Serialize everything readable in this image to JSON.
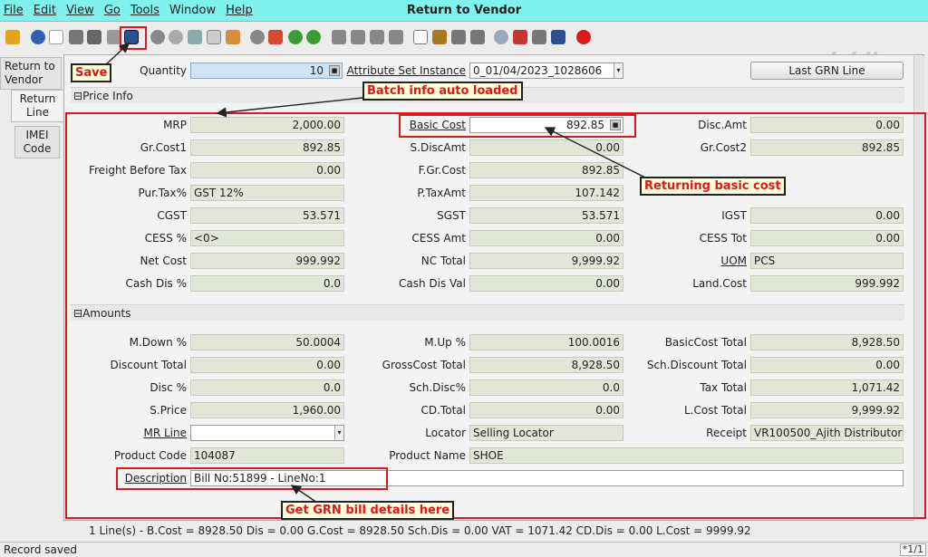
{
  "window": {
    "title": "Return to Vendor"
  },
  "menu": [
    "File",
    "Edit",
    "View",
    "Go",
    "Tools",
    "Window",
    "Help"
  ],
  "brand": "jaldi",
  "tabs": [
    "Return to Vendor",
    "Return Line",
    "IMEI Code"
  ],
  "top": {
    "quantity_label": "Quantity",
    "quantity": "10",
    "attr_label": "Attribute Set Instance",
    "attr_value": "0_01/04/2023_1028606",
    "last_grn": "Last GRN Line"
  },
  "price_section": "Price Info",
  "amount_section": "Amounts",
  "price": {
    "mrp_l": "MRP",
    "mrp": "2,000.00",
    "basic_l": "Basic Cost",
    "basic": "892.85",
    "disc_l": "Disc.Amt",
    "disc": "0.00",
    "grc1_l": "Gr.Cost1",
    "grc1": "892.85",
    "sdisc_l": "S.DiscAmt",
    "sdisc": "0.00",
    "grc2_l": "Gr.Cost2",
    "grc2": "892.85",
    "fbt_l": "Freight Before Tax",
    "fbt": "0.00",
    "fgr_l": "F.Gr.Cost",
    "fgr": "892.85",
    "ptax_l": "Pur.Tax%",
    "ptax": "GST 12%",
    "ptaxamt_l": "P.TaxAmt",
    "ptaxamt": "107.142",
    "cgst_l": "CGST",
    "cgst": "53.571",
    "sgst_l": "SGST",
    "sgst": "53.571",
    "igst_l": "IGST",
    "igst": "0.00",
    "cess_l": "CESS %",
    "cess": "<0>",
    "cessamt_l": "CESS Amt",
    "cessamt": "0.00",
    "cesstot_l": "CESS Tot",
    "cesstot": "0.00",
    "net_l": "Net Cost",
    "net": "999.992",
    "nct_l": "NC Total",
    "nct": "9,999.92",
    "uom_l": "UOM",
    "uom": "PCS",
    "cdp_l": "Cash Dis %",
    "cdp": "0.0",
    "cdv_l": "Cash Dis Val",
    "cdv": "0.00",
    "land_l": "Land.Cost",
    "land": "999.992"
  },
  "amounts": {
    "mdown_l": "M.Down %",
    "mdown": "50.0004",
    "mup_l": "M.Up %",
    "mup": "100.0016",
    "bct_l": "BasicCost Total",
    "bct": "8,928.50",
    "dt_l": "Discount Total",
    "dt": "0.00",
    "gct_l": "GrossCost Total",
    "gct": "8,928.50",
    "sdt_l": "Sch.Discount Total",
    "sdt": "0.00",
    "dp_l": "Disc %",
    "dp": "0.0",
    "sdp_l": "Sch.Disc%",
    "sdp": "0.0",
    "tt_l": "Tax Total",
    "tt": "1,071.42",
    "sp_l": "S.Price",
    "sp": "1,960.00",
    "cdt_l": "CD.Total",
    "cdt": "0.00",
    "lct_l": "L.Cost Total",
    "lct": "9,999.92",
    "mr_l": "MR Line",
    "mr": "",
    "loc_l": "Locator",
    "loc": "Selling Locator",
    "rec_l": "Receipt",
    "rec": "VR100500_Ajith Distributor",
    "pc_l": "Product Code",
    "pc": "104087",
    "pn_l": "Product Name",
    "pn": "SHOE",
    "desc_l": "Description",
    "desc": "Bill No:51899 - LineNo:1"
  },
  "summary": "1 Line(s) -   B.Cost = 8928.50   Dis = 0.00   G.Cost = 8928.50   Sch.Dis = 0.00   VAT = 1071.42   CD.Dis = 0.00   L.Cost = 9999.92",
  "status": "Record saved",
  "page_indicator": "*1/1",
  "callouts": {
    "save": "Save",
    "batch": "Batch info auto loaded",
    "basic": "Returning basic cost",
    "grn": "Get GRN bill details here"
  },
  "colors": {
    "accent": "#7ff2ee",
    "annotation": "#e0161a",
    "field": "#e1e6d7"
  }
}
